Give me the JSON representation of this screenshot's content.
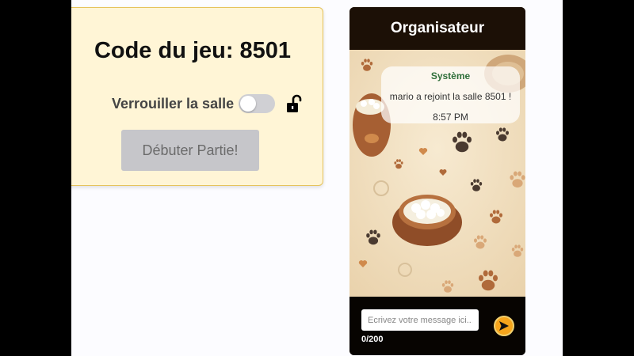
{
  "game": {
    "code_label": "Code du jeu:",
    "code_value": "8501",
    "lock_label": "Verrouiller la salle",
    "lock_enabled": false,
    "start_button": "Débuter Partie!"
  },
  "chat": {
    "title": "Organisateur",
    "messages": [
      {
        "author": "Système",
        "text": "mario a rejoint la salle 8501 !",
        "time": "8:57 PM"
      }
    ],
    "input_placeholder": "Ecrivez votre message ici...",
    "char_count": "0/200"
  },
  "colors": {
    "card_bg": "#fff5d6",
    "card_border": "#e6c35c",
    "chat_dark": "#1c1006",
    "system_author": "#2f6f3a",
    "send_button": "#f6a51c"
  },
  "icons": {
    "lock": "unlocked-padlock-icon",
    "send": "send-arrow-icon"
  }
}
